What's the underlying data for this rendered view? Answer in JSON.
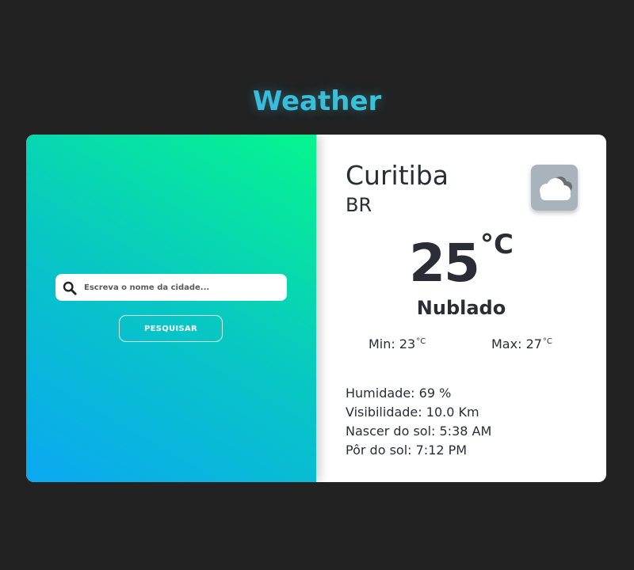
{
  "app": {
    "title": "Weather"
  },
  "search": {
    "placeholder": "Escreva o nome da cidade...",
    "value": "",
    "button_label": "PESQUISAR",
    "icon": "search-icon"
  },
  "weather": {
    "city": "Curitiba",
    "country": "BR",
    "icon": "cloud-icon",
    "temperature": "25",
    "unit": "°C",
    "condition": "Nublado",
    "min_label": "Min:",
    "min_value": "23",
    "max_label": "Max:",
    "max_value": "27",
    "details": [
      {
        "label": "Humidade:",
        "value": "69 %"
      },
      {
        "label": "Visibilidade:",
        "value": "10.0 Km"
      },
      {
        "label": "Nascer do sol:",
        "value": "5:38 AM"
      },
      {
        "label": "Pôr do sol:",
        "value": "7:12 PM"
      }
    ]
  },
  "colors": {
    "background": "#222222",
    "gradient_start": "#0aa8f2",
    "gradient_end": "#06f58e",
    "title_gradient_start": "#35a7f0",
    "title_gradient_end": "#3fd6c4",
    "text_dark": "#2a2d36"
  }
}
